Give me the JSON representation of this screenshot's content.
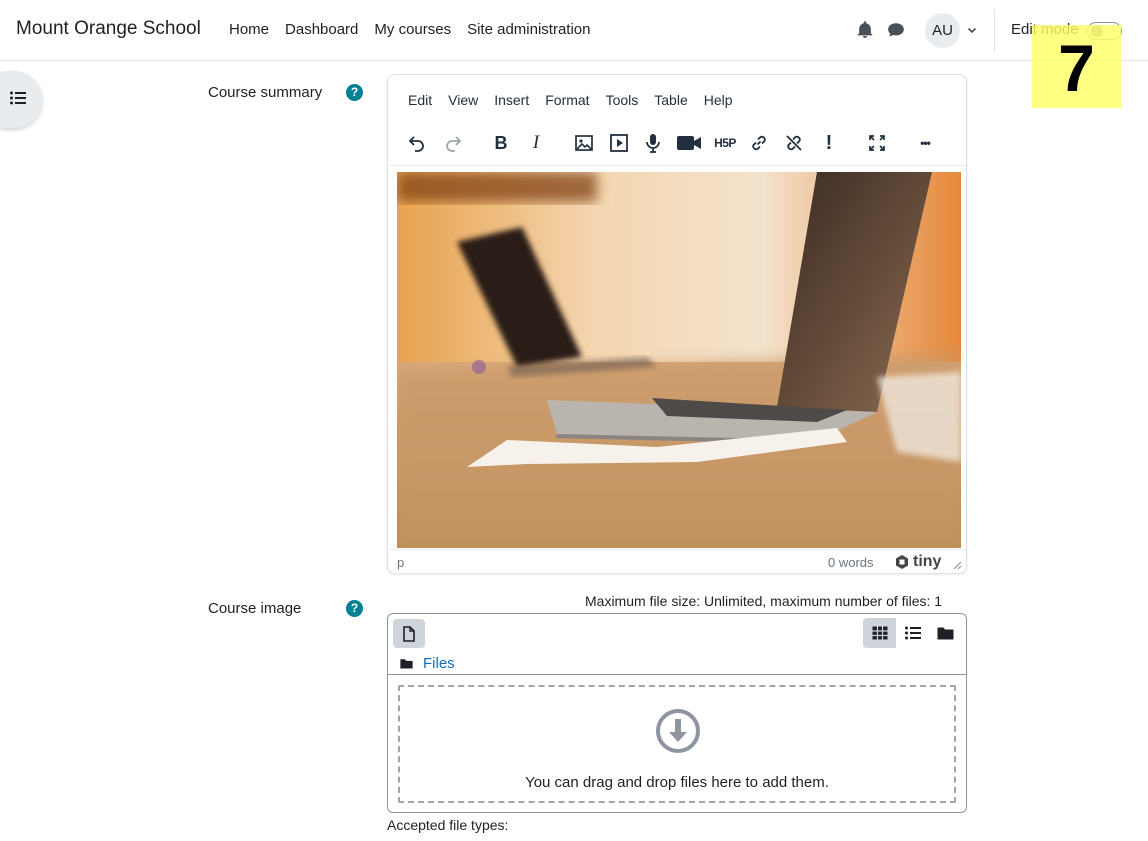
{
  "navbar": {
    "brand": "Mount Orange School",
    "links": [
      "Home",
      "Dashboard",
      "My courses",
      "Site administration"
    ],
    "avatar_initials": "AU",
    "edit_mode_label": "Edit mode",
    "edit_mode_on": false
  },
  "step_badge": "7",
  "form": {
    "course_summary_label": "Course summary",
    "course_image_label": "Course image",
    "help_glyph": "?"
  },
  "editor": {
    "menu": [
      "Edit",
      "View",
      "Insert",
      "Format",
      "Tools",
      "Table",
      "Help"
    ],
    "toolbar": [
      "undo-icon",
      "redo-icon",
      "bold-icon",
      "italic-icon",
      "image-icon",
      "media-icon",
      "microphone-icon",
      "video-camera-icon",
      "h5p-icon",
      "link-icon",
      "unlink-icon",
      "exclamation-icon",
      "fullscreen-icon",
      "more-icon"
    ],
    "bold_glyph": "B",
    "italic_glyph": "I",
    "h5p_glyph": "H5P",
    "exclamation_glyph": "!",
    "more_glyph": "•••",
    "status_path": "p",
    "word_count": "0 words",
    "tiny_brand": "tiny"
  },
  "filepicker": {
    "max_size_text": "Maximum file size: Unlimited, maximum number of files: 1",
    "path_label": "Files",
    "dropzone_text": "You can drag and drop files here to add them.",
    "accepted_types_label": "Accepted file types:",
    "active_view": "grid"
  },
  "colors": {
    "help_icon": "#008196",
    "link": "#0f6cbf",
    "badge": "#ffff66"
  }
}
